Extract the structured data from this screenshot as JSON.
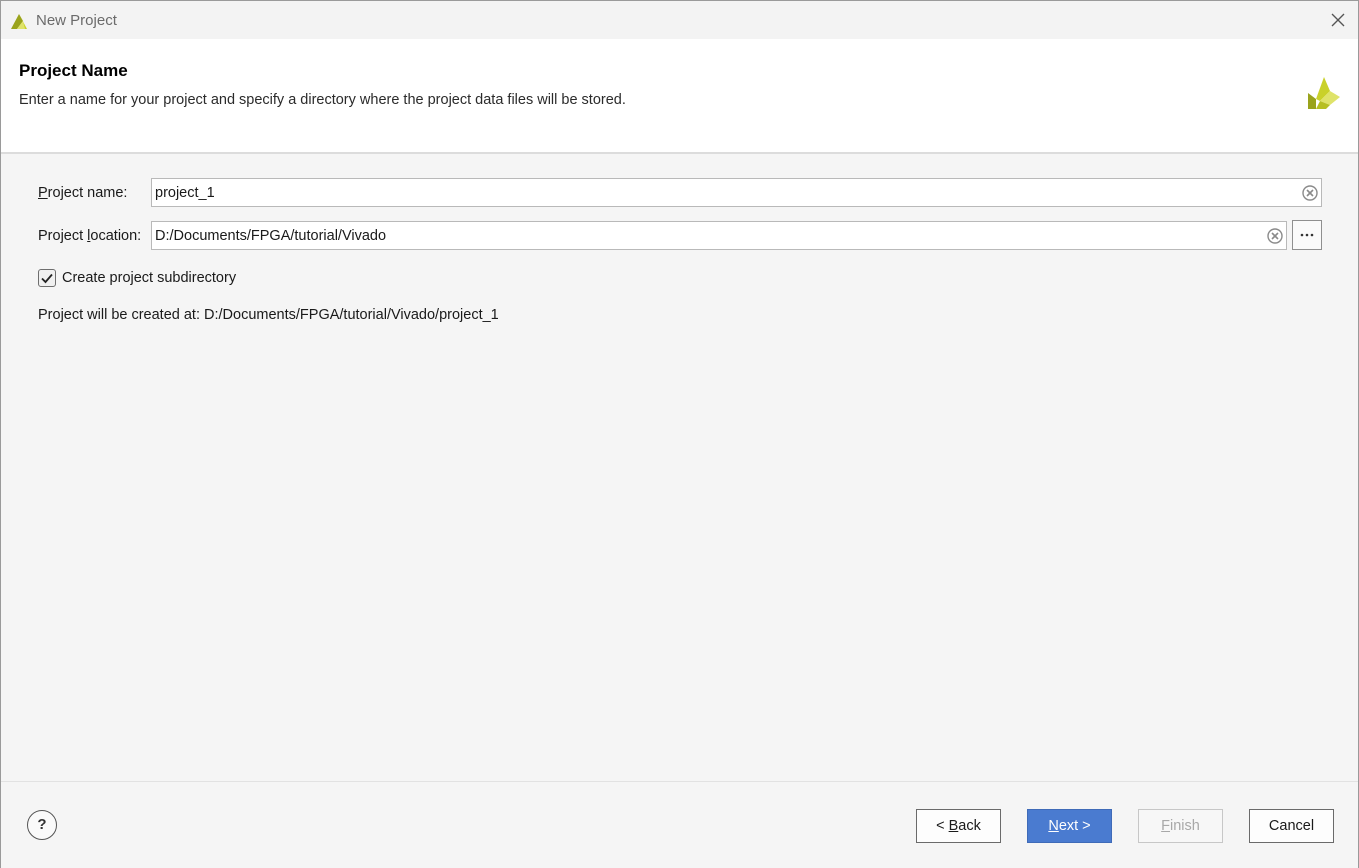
{
  "window": {
    "title": "New Project"
  },
  "header": {
    "title": "Project Name",
    "description": "Enter a name for your project and specify a directory where the project data files will be stored."
  },
  "form": {
    "project_name": {
      "label_underlined": "P",
      "label_rest": "roject name:",
      "value": "project_1"
    },
    "project_location": {
      "label_pre": "Project ",
      "label_underlined": "l",
      "label_rest": "ocation:",
      "value": "D:/Documents/FPGA/tutorial/Vivado",
      "browse_label": "···"
    },
    "subdirectory": {
      "label": "Create project subdirectory",
      "checked": true
    },
    "created_at": "Project will be created at: D:/Documents/FPGA/tutorial/Vivado/project_1"
  },
  "footer": {
    "help_label": "?",
    "back": {
      "prefix": "< ",
      "underlined": "B",
      "rest": "ack"
    },
    "next": {
      "underlined": "N",
      "rest": "ext >"
    },
    "finish": {
      "underlined": "F",
      "rest": "inish"
    },
    "cancel": "Cancel"
  },
  "colors": {
    "accent": "#4a7bd0",
    "logo_yellow": "#c9d12a",
    "logo_olive": "#9aa31c"
  },
  "icons": [
    "vivado-logo-icon",
    "close-icon",
    "clear-icon",
    "ellipsis-icon",
    "checkmark-icon",
    "help-icon"
  ]
}
